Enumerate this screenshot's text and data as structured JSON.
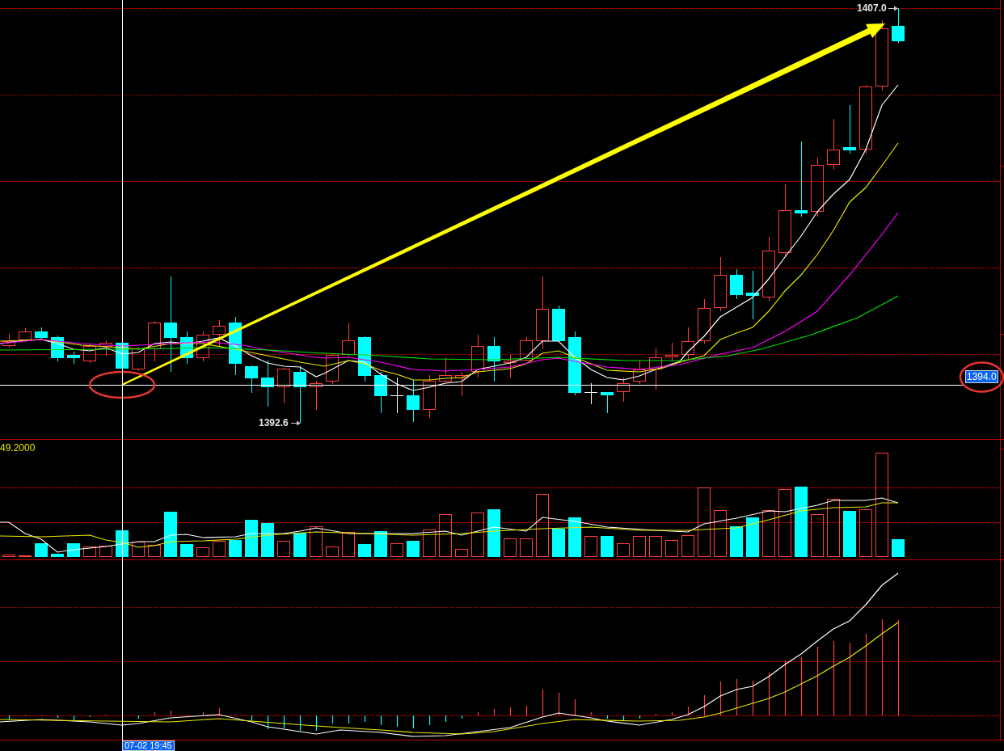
{
  "price_chart": {
    "high_label": "1407.0",
    "low_label": "1392.6",
    "crosshair_price": "1394.0"
  },
  "volume_chart": {
    "max_label": "49.2000"
  },
  "time_axis": {
    "crosshair_time": "07-02 19:45"
  }
}
